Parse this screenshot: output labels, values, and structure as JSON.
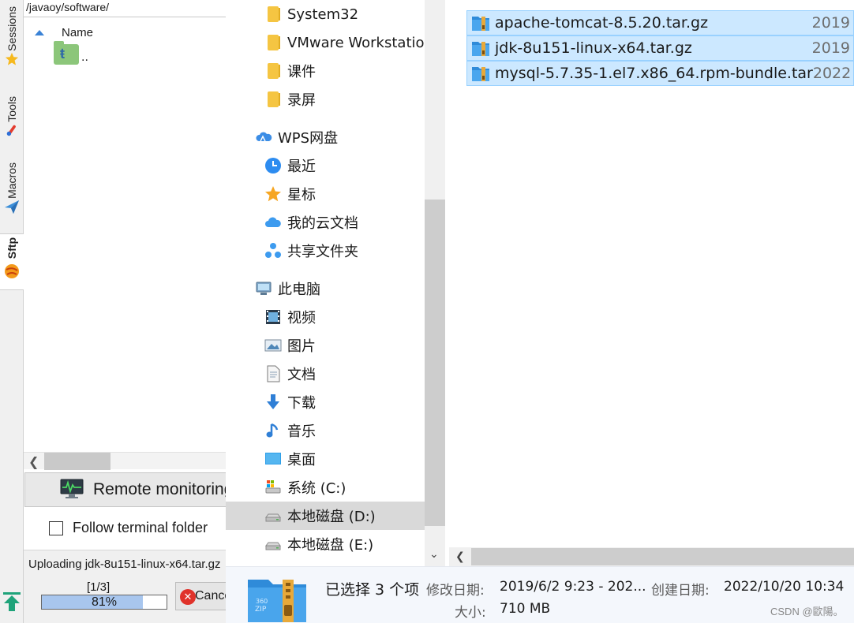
{
  "sidebar_tabs": [
    {
      "label": "Sessions",
      "icon": "star-icon"
    },
    {
      "label": "Tools",
      "icon": "wrench-icon"
    },
    {
      "label": "Macros",
      "icon": "paper-plane-icon"
    },
    {
      "label": "Sftp",
      "icon": "sftp-ball-icon"
    }
  ],
  "sftp": {
    "path": "/javaoy/software/",
    "column_name": "Name",
    "parent_dir": "..",
    "remote_monitoring": "Remote monitoring",
    "follow_terminal": "Follow terminal folder",
    "upload_text": "Uploading jdk-8u151-linux-x64.tar.gz",
    "upload_count": "[1/3]",
    "upload_percent": "81%",
    "upload_progress": 0.81,
    "cancel_label": "Cancel"
  },
  "nav": {
    "items": [
      {
        "label": "System32",
        "icon": "folder-icon",
        "level": 1
      },
      {
        "label": "VMware Workstation",
        "icon": "folder-icon",
        "level": 1
      },
      {
        "label": "课件",
        "icon": "folder-icon",
        "level": 1
      },
      {
        "label": "录屏",
        "icon": "folder-icon",
        "level": 1
      },
      {
        "label": "WPS网盘",
        "icon": "wps-cloud-icon",
        "level": 0
      },
      {
        "label": "最近",
        "icon": "clock-icon",
        "level": 1
      },
      {
        "label": "星标",
        "icon": "star-icon",
        "level": 1
      },
      {
        "label": "我的云文档",
        "icon": "cloud-icon",
        "level": 1
      },
      {
        "label": "共享文件夹",
        "icon": "share-icon",
        "level": 1
      },
      {
        "label": "此电脑",
        "icon": "computer-icon",
        "level": 0
      },
      {
        "label": "视频",
        "icon": "video-icon",
        "level": 1
      },
      {
        "label": "图片",
        "icon": "picture-icon",
        "level": 1
      },
      {
        "label": "文档",
        "icon": "document-icon",
        "level": 1
      },
      {
        "label": "下载",
        "icon": "download-icon",
        "level": 1
      },
      {
        "label": "音乐",
        "icon": "music-icon",
        "level": 1
      },
      {
        "label": "桌面",
        "icon": "desktop-icon",
        "level": 1
      },
      {
        "label": "系统 (C:)",
        "icon": "system-drive-icon",
        "level": 1
      },
      {
        "label": "本地磁盘 (D:)",
        "icon": "drive-icon",
        "level": 1,
        "selected": true
      },
      {
        "label": "本地磁盘 (E:)",
        "icon": "drive-icon",
        "level": 1
      }
    ]
  },
  "files": [
    {
      "name": "apache-tomcat-8.5.20.tar.gz",
      "date": "2019"
    },
    {
      "name": "jdk-8u151-linux-x64.tar.gz",
      "date": "2019"
    },
    {
      "name": "mysql-5.7.35-1.el7.x86_64.rpm-bundle.tar",
      "date": "2022"
    }
  ],
  "details": {
    "selected_text": "已选择 3 个项",
    "modified_label": "修改日期:",
    "modified_value": "2019/6/2 9:23 - 202...",
    "created_label": "创建日期:",
    "created_value": "2022/10/20 10:34",
    "size_label": "大小:",
    "size_value": "710 MB",
    "watermark": "CSDN @歐陽。"
  },
  "colors": {
    "selection_bg": "#cce8ff",
    "selection_border": "#99d1ff",
    "progress_fill": "#a8c6ee"
  }
}
